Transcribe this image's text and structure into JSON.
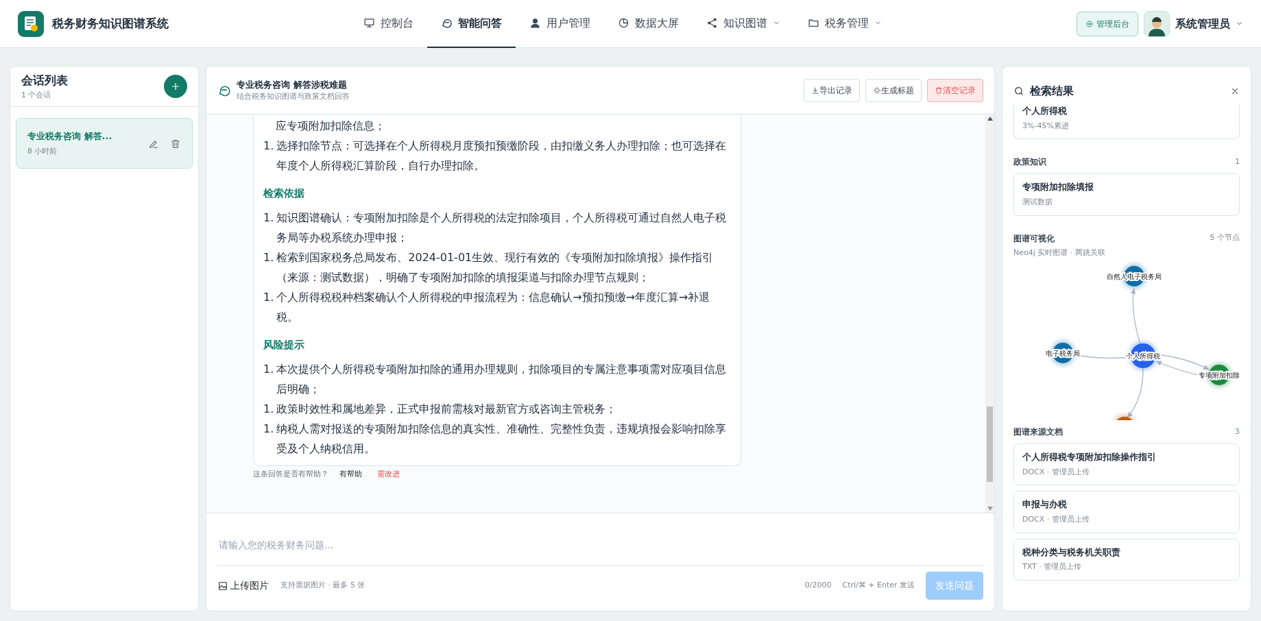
{
  "app": {
    "title": "税务财务知识图谱系统"
  },
  "nav": [
    {
      "label": "控制台",
      "selected": false,
      "dropdown": false
    },
    {
      "label": "智能问答",
      "selected": true,
      "dropdown": false
    },
    {
      "label": "用户管理",
      "selected": false,
      "dropdown": false
    },
    {
      "label": "数据大屏",
      "selected": false,
      "dropdown": false
    },
    {
      "label": "知识图谱",
      "selected": false,
      "dropdown": true
    },
    {
      "label": "税务管理",
      "selected": false,
      "dropdown": true
    }
  ],
  "admin_button": "管理后台",
  "user": {
    "name": "系统管理员"
  },
  "sessions": {
    "title": "会话列表",
    "count": "1 个会话",
    "items": [
      {
        "title": "专业税务咨询 解答...",
        "time": "8 小时前",
        "selected": true
      }
    ]
  },
  "chat": {
    "title": "专业税务咨询 解答涉税难题",
    "subtitle": "结合税务知识图谱与政策文档回答",
    "actions": [
      {
        "label": "导出记录",
        "kind": "export"
      },
      {
        "label": "生成标题",
        "kind": "generate"
      },
      {
        "label": "清空记录",
        "kind": "danger"
      }
    ],
    "message": [
      {
        "kind": "continuation",
        "text": "应专项附加扣除信息；"
      },
      {
        "kind": "item",
        "marker": "1.",
        "text": "选择扣除节点：可选择在个人所得税月度预扣预缴阶段，由扣缴义务人办理扣除；也可选择在年度个人所得税汇算阶段，自行办理扣除。"
      },
      {
        "kind": "heading",
        "text": "检索依据"
      },
      {
        "kind": "item",
        "marker": "1.",
        "text": "知识图谱确认：专项附加扣除是个人所得税的法定扣除项目，个人所得税可通过自然人电子税务局等办税系统办理申报；"
      },
      {
        "kind": "item",
        "marker": "1.",
        "text": "检索到国家税务总局发布、2024-01-01生效、现行有效的《专项附加扣除填报》操作指引（来源：测试数据），明确了专项附加扣除的填报渠道与扣除办理节点规则；"
      },
      {
        "kind": "item",
        "marker": "1.",
        "text": "个人所得税税种档案确认个人所得税的申报流程为：信息确认→预扣预缴→年度汇算→补退税。"
      },
      {
        "kind": "heading",
        "text": "风险提示"
      },
      {
        "kind": "item",
        "marker": "1.",
        "text": "本次提供个人所得税专项附加扣除的通用办理规则，扣除项目的专属注意事项需对应项目信息后明确；"
      },
      {
        "kind": "item",
        "marker": "1.",
        "text": "政策时效性和属地差异，正式申报前需核对最新官方或咨询主管税务；"
      },
      {
        "kind": "item",
        "marker": "1.",
        "text": "纳税人需对报送的专项附加扣除信息的真实性、准确性、完整性负责，违规填报会影响扣除享受及个人纳税信用。"
      }
    ],
    "feedback": {
      "question": "这条回答是否有帮助？",
      "helpful": "有帮助",
      "improve": "需改进"
    },
    "input": {
      "placeholder": "请输入您的税务财务问题...",
      "upload": "上传图片",
      "upload_hint": "支持票据图片 · 最多 5 张",
      "counter": "0/2000",
      "shortcut": "Ctrl/⌘ + Enter 发送",
      "send": "发送问题",
      "send_disabled": true
    }
  },
  "results": {
    "title": "检索结果",
    "top_card": {
      "title": "个人所得税",
      "subtitle": "3%-45%累进"
    },
    "policy": {
      "title": "政策知识",
      "count": "1",
      "items": [
        {
          "title": "专项附加扣除填报",
          "subtitle": "测试数据"
        }
      ]
    },
    "graph": {
      "title": "图谱可视化",
      "count": "5 个节点",
      "subtitle": "Neo4j 实时图谱 · 两跳关联",
      "nodes": [
        {
          "label": "自然人电子税务局",
          "color": "#0e6ea8"
        },
        {
          "label": "个人所得税",
          "color": "#2563eb"
        },
        {
          "label": "电子税务局",
          "color": "#0e6ea8"
        },
        {
          "label": "专项附加扣除",
          "color": "#1a8a3e"
        },
        {
          "color": "#c2570c"
        }
      ]
    },
    "docs": {
      "title": "图谱来源文档",
      "count": "3",
      "items": [
        {
          "title": "个人所得税专项附加扣除操作指引",
          "meta": "DOCX · 管理员上传"
        },
        {
          "title": "申报与办税",
          "meta": "DOCX · 管理员上传"
        },
        {
          "title": "税种分类与税务机关职责",
          "meta": "TXT · 管理员上传"
        }
      ]
    }
  }
}
